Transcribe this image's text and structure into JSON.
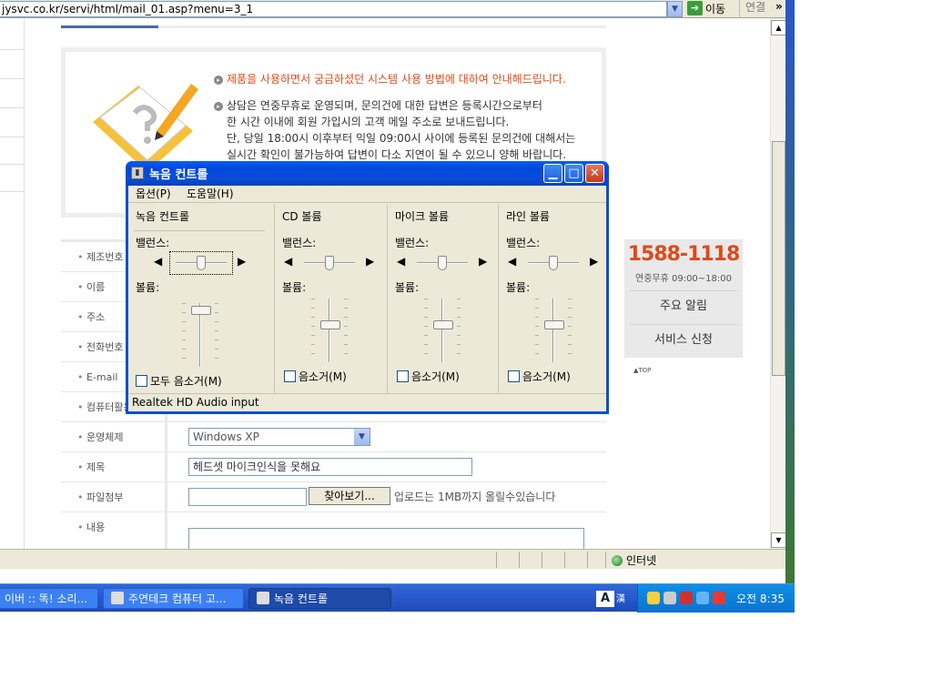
{
  "browser": {
    "address": "jysvc.co.kr/servi/html/mail_01.asp?menu=3_1",
    "go_label": "이동",
    "links_label": "연결",
    "chevron": "»",
    "zone_label": "인터넷"
  },
  "page": {
    "info_lines": [
      "제품을 사용하면서 궁금하셨던 시스템 사용 방법에 대하여 안내해드립니다.",
      "상담은 연중무휴로 운영되며, 문의건에 대한 답변은 등록시간으로부터",
      "한 시간 이내에 회원 가입시의 고객 메일 주소로 보내드립니다.",
      "단, 당일 18:00시 이후부터 익일 09:00시 사이에 등록된 문의건에 대해서는",
      "실시간 확인이 불가능하여 답변이 다소 지연이 될 수 있으니 양해 바랍니다."
    ],
    "form": {
      "labels": [
        "제조번호",
        "이름",
        "주소",
        "전화번호",
        "E-mail",
        "컴퓨터활용",
        "운영체제",
        "제목",
        "파일첨부",
        "내용"
      ],
      "os_value": "Windows XP",
      "title_value": "헤드셋 마이크인식을 못해요",
      "browse_label": "찾아보기...",
      "upload_hint": "업로드는 1MB까지 올릴수있습니다"
    },
    "callbox": {
      "phone": "1588-1118",
      "hours": "연중무휴 09:00~18:00",
      "btn_notice": "주요 알림",
      "btn_service": "서비스 신청"
    },
    "top_link": "▲TOP"
  },
  "dialog": {
    "title": "녹음 컨트롤",
    "menu_options": "옵션(P)",
    "menu_help": "도움말(H)",
    "columns": [
      {
        "title": "녹음 컨트롤",
        "balance": "밸런스:",
        "volume": "볼륨:",
        "mute": "모두 음소거(M)",
        "volume_level": 0.95,
        "balance_level": 0.5
      },
      {
        "title": "CD 볼륨",
        "balance": "밸런스:",
        "volume": "볼륨:",
        "mute": "음소거(M)",
        "volume_level": 0.6,
        "balance_level": 0.5
      },
      {
        "title": "마이크 볼륨",
        "balance": "밸런스:",
        "volume": "볼륨:",
        "mute": "음소거(M)",
        "volume_level": 0.6,
        "balance_level": 0.5
      },
      {
        "title": "라인 볼륨",
        "balance": "밸런스:",
        "volume": "볼륨:",
        "mute": "음소거(M)",
        "volume_level": 0.6,
        "balance_level": 0.5
      }
    ],
    "status": "Realtek HD Audio input"
  },
  "taskbar": {
    "tasks": [
      "이버 :: 똑! 소리...",
      "주연테크 컴퓨터 고...",
      "녹음 컨트롤"
    ],
    "lang": "A",
    "lang2": "漢",
    "clock": "오전 8:35"
  }
}
